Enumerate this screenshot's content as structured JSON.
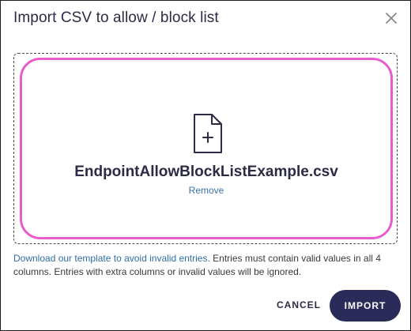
{
  "dialog": {
    "title": "Import CSV to allow / block list",
    "close_icon": "close-icon"
  },
  "dropzone": {
    "file_icon": "file-add-icon",
    "file_name": "EndpointAllowBlockListExample.csv",
    "remove_label": "Remove",
    "highlight_color": "#e85cd0"
  },
  "help": {
    "link_text": "Download our template to avoid invalid entries.",
    "text": " Entries must contain valid values in all 4 columns. Entries with extra columns or invalid values will be ignored."
  },
  "actions": {
    "cancel_label": "CANCEL",
    "import_label": "IMPORT",
    "primary_color": "#2b2b5a"
  }
}
